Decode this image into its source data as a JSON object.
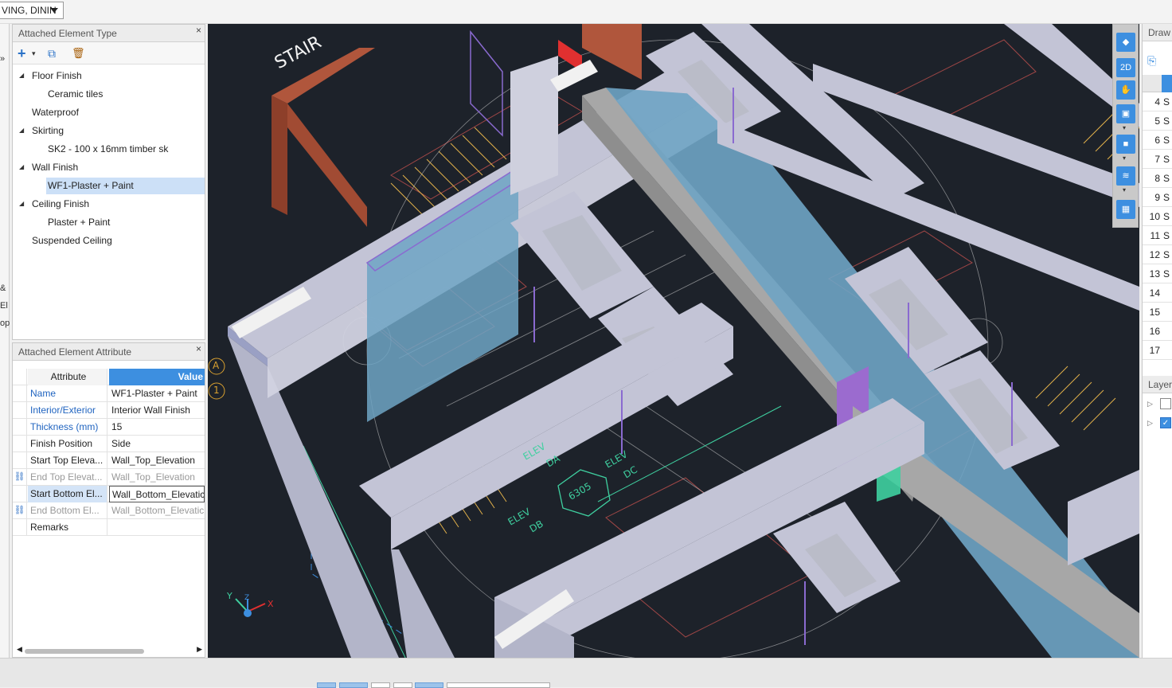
{
  "top": {
    "view_dropdown": "VING, DININ"
  },
  "left_strip": {
    "glyphs": [
      "»",
      "&",
      "El",
      "op"
    ]
  },
  "type_panel": {
    "title": "Attached Element Type",
    "close": "×",
    "toolbar": {
      "add": "+",
      "add_arrow": "▾",
      "copy": "⧉",
      "delete": "🗑"
    },
    "tree": [
      {
        "label": "Floor Finish",
        "level": 0,
        "expanded": true
      },
      {
        "label": "Ceramic tiles",
        "level": 1
      },
      {
        "label": "Waterproof",
        "level": 0
      },
      {
        "label": "Skirting",
        "level": 0,
        "expanded": true
      },
      {
        "label": "SK2 - 100 x 16mm timber sk",
        "level": 1
      },
      {
        "label": "Wall Finish",
        "level": 0,
        "expanded": true
      },
      {
        "label": "WF1-Plaster + Paint",
        "level": 1,
        "selected": true
      },
      {
        "label": "Ceiling Finish",
        "level": 0,
        "expanded": true
      },
      {
        "label": "Plaster + Paint",
        "level": 1
      },
      {
        "label": "Suspended Ceiling",
        "level": 0
      }
    ]
  },
  "attr_panel": {
    "title": "Attached Element Attribute",
    "close": "×",
    "col_attribute": "Attribute",
    "col_value": "Value",
    "rows": [
      {
        "name": "Name",
        "value": "WF1-Plaster + Paint",
        "style": "blue"
      },
      {
        "name": "Interior/Exterior",
        "value": "Interior Wall Finish",
        "style": "blue"
      },
      {
        "name": "Thickness (mm)",
        "value": "15",
        "style": "blue"
      },
      {
        "name": "Finish Position",
        "value": "Side",
        "style": "normal"
      },
      {
        "name": "Start Top Eleva...",
        "value": "Wall_Top_Elevation",
        "style": "normal"
      },
      {
        "name": "End Top Elevat...",
        "value": "Wall_Top_Elevation",
        "style": "grey",
        "linked": true
      },
      {
        "name": "Start Bottom El...",
        "value": "Wall_Bottom_Elevatic",
        "style": "normal",
        "selected": true
      },
      {
        "name": "End Bottom El...",
        "value": "Wall_Bottom_Elevatic",
        "style": "grey",
        "linked": true
      },
      {
        "name": "Remarks",
        "value": "",
        "style": "normal"
      }
    ]
  },
  "viewport": {
    "labels": {
      "stair": "STAIR",
      "elev_da": "ELEV",
      "da": "DA",
      "elev_dc": "ELEV",
      "dc": "DC",
      "elev_db": "ELEV",
      "db": "DB",
      "circle_num": "6305",
      "grid_a": "A",
      "grid_1": "1",
      "axis_x": "X",
      "axis_y": "Y",
      "axis_z": "Z"
    },
    "colors": {
      "background": "#1d222a",
      "wall": "#c3c4d6",
      "wall_top": "#9aa0c4",
      "glass": "#6fa4c4",
      "brick": "#b0563c",
      "beam": "#a7a7a7",
      "cad_red": "#c0504d",
      "cad_yellow": "#e0b04a",
      "cad_green": "#3fd0a0",
      "purple": "#8a6ad0"
    }
  },
  "view_tools": {
    "tools": [
      "cube-icon",
      "2D",
      "hand-icon",
      "box-icon",
      "solid-icon",
      "layers-icon",
      "grid-icon"
    ]
  },
  "right_panel": {
    "title": "Draw",
    "rows": [
      {
        "n": "4",
        "s": "S"
      },
      {
        "n": "5",
        "s": "S"
      },
      {
        "n": "6",
        "s": "S"
      },
      {
        "n": "7",
        "s": "S"
      },
      {
        "n": "8",
        "s": "S"
      },
      {
        "n": "9",
        "s": "S"
      },
      {
        "n": "10",
        "s": "S"
      },
      {
        "n": "11",
        "s": "S"
      },
      {
        "n": "12",
        "s": "S"
      },
      {
        "n": "13",
        "s": "S"
      },
      {
        "n": "14",
        "s": ""
      },
      {
        "n": "15",
        "s": ""
      },
      {
        "n": "16",
        "s": ""
      },
      {
        "n": "17",
        "s": ""
      }
    ],
    "layers_title": "Layer"
  }
}
